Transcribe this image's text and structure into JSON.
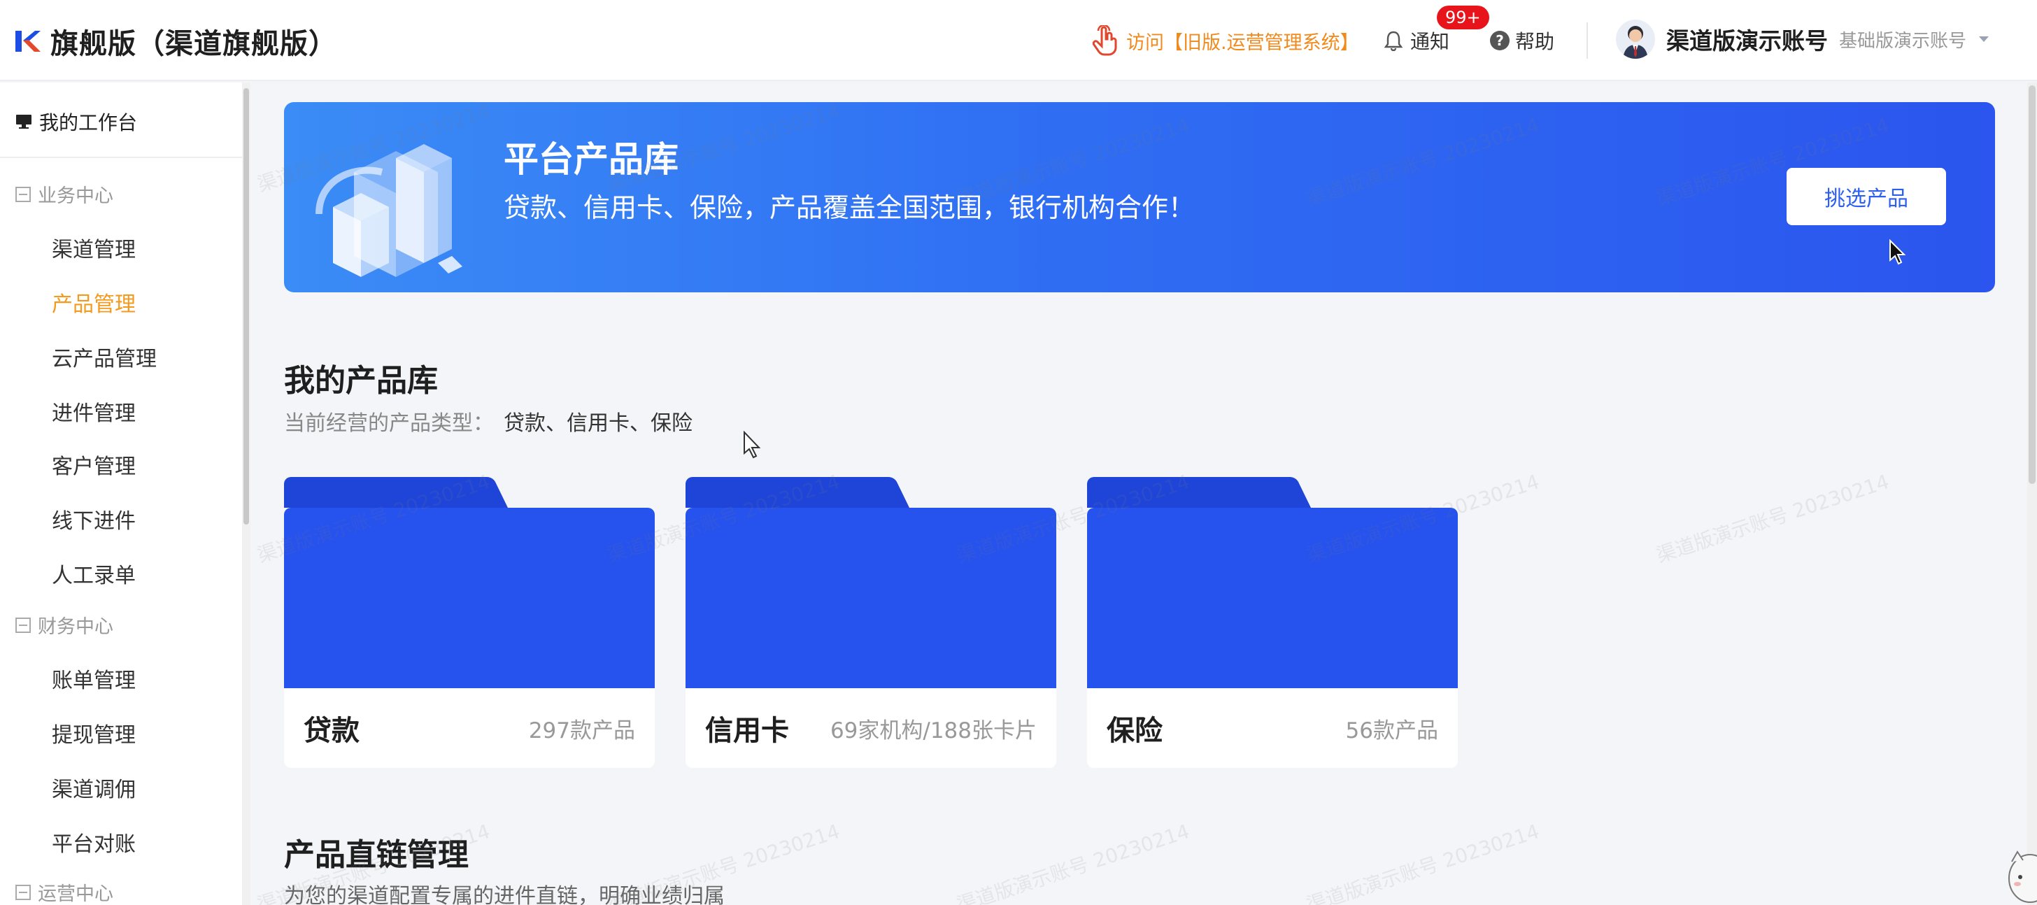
{
  "header": {
    "logo_letter": "K",
    "title": "旗舰版（渠道旗舰版）",
    "visit_link": "访问【旧版.运营管理系统】",
    "notify_label": "通知",
    "notify_badge": "99+",
    "help_label": "帮助",
    "help_icon_glyph": "?",
    "account_name": "渠道版演示账号",
    "account_sub": "基础版演示账号"
  },
  "sidebar": {
    "workbench": "我的工作台",
    "groups": [
      {
        "label": "业务中心",
        "items": [
          "渠道管理",
          "产品管理",
          "云产品管理",
          "进件管理",
          "客户管理",
          "线下进件",
          "人工录单"
        ]
      },
      {
        "label": "财务中心",
        "items": [
          "账单管理",
          "提现管理",
          "渠道调佣",
          "平台对账"
        ]
      },
      {
        "label": "运营中心",
        "items": []
      }
    ],
    "active_item": "产品管理"
  },
  "banner": {
    "title": "平台产品库",
    "subtitle": "贷款、信用卡、保险，产品覆盖全国范围，银行机构合作！",
    "button": "挑选产品"
  },
  "my_library": {
    "title": "我的产品库",
    "types_label": "当前经营的产品类型：",
    "types_value": "贷款、信用卡、保险",
    "cards": [
      {
        "name": "贷款",
        "count": "297款产品"
      },
      {
        "name": "信用卡",
        "count": "69家机构/188张卡片"
      },
      {
        "name": "保险",
        "count": "56款产品"
      }
    ]
  },
  "direct_link": {
    "title": "产品直链管理",
    "desc": "为您的渠道配置专属的进件直链，明确业绩归属"
  },
  "watermark_text": "渠道版演示账号 20230214",
  "colors": {
    "accent_orange": "#f39a1f",
    "banner_blue": "#2f6ef3",
    "folder_blue": "#2652ee",
    "folder_tab": "#1f45d8",
    "badge_red": "#e8141b"
  },
  "icons": {
    "logo": "k-logo-icon",
    "visit": "hand-pointer-icon",
    "notify": "bell-icon",
    "help": "question-circle-icon",
    "dropdown": "caret-down-icon",
    "workbench": "monitor-icon",
    "group_toggle": "minus-box-icon"
  }
}
